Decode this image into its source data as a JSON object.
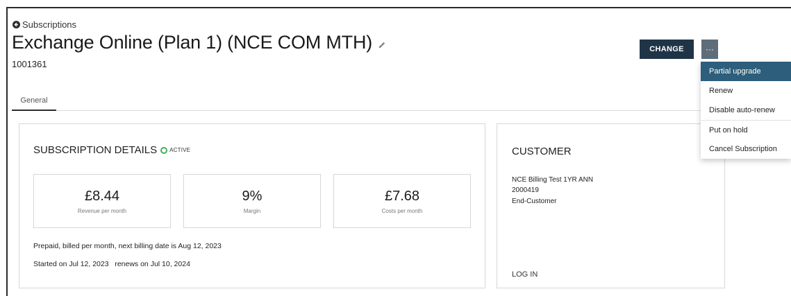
{
  "breadcrumb": {
    "back_label": "Subscriptions"
  },
  "header": {
    "title": "Exchange Online (Plan 1) (NCE COM MTH)",
    "subscription_id": "1001361",
    "change_label": "CHANGE",
    "more_label": "···"
  },
  "tabs": [
    {
      "label": "General",
      "active": true
    }
  ],
  "dropdown": {
    "items": [
      {
        "label": "Partial upgrade",
        "highlighted": true
      },
      {
        "label": "Renew"
      },
      {
        "label": "Disable auto-renew"
      },
      {
        "label": "Put on hold"
      },
      {
        "label": "Cancel Subscription"
      }
    ]
  },
  "subscription_details": {
    "title": "SUBSCRIPTION DETAILS",
    "status": "ACTIVE",
    "status_color": "#3cb35c",
    "stats": [
      {
        "value": "£8.44",
        "label": "Revenue per month"
      },
      {
        "value": "9%",
        "label": "Margin"
      },
      {
        "value": "£7.68",
        "label": "Costs per month"
      }
    ],
    "billing_line": "Prepaid, billed per month, next billing date is Aug 12, 2023",
    "term_line": "Started on Jul 12, 2023   renews on Jul 10, 2024"
  },
  "customer": {
    "title": "CUSTOMER",
    "name": "NCE Billing Test 1YR ANN",
    "id": "2000419",
    "type": "End-Customer",
    "login_label": "LOG IN"
  },
  "colors": {
    "primary_button": "#1f3447",
    "menu_highlight": "#2d5e7b",
    "active_status": "#3cb35c"
  },
  "icons": {
    "back": "circle-arrow-left-icon",
    "edit": "pencil-icon",
    "more": "ellipsis-icon",
    "status": "ring-status-icon"
  }
}
